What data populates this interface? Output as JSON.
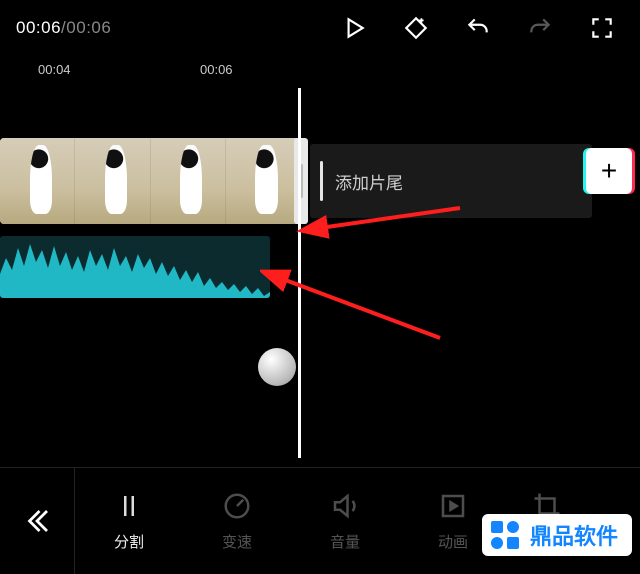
{
  "time": {
    "current": "00:06",
    "separator": "/",
    "total": "00:06"
  },
  "ruler": {
    "t0": "00:04",
    "t1": "00:06"
  },
  "addClip": {
    "label": "添加片尾"
  },
  "addButton": {
    "glyph": "+"
  },
  "tools": {
    "split": {
      "label": "分割"
    },
    "speed": {
      "label": "变速"
    },
    "volume": {
      "label": "音量"
    },
    "anim": {
      "label": "动画"
    },
    "crop": {
      "label": "裁剪"
    }
  },
  "watermark": {
    "text": "鼎品软件"
  }
}
